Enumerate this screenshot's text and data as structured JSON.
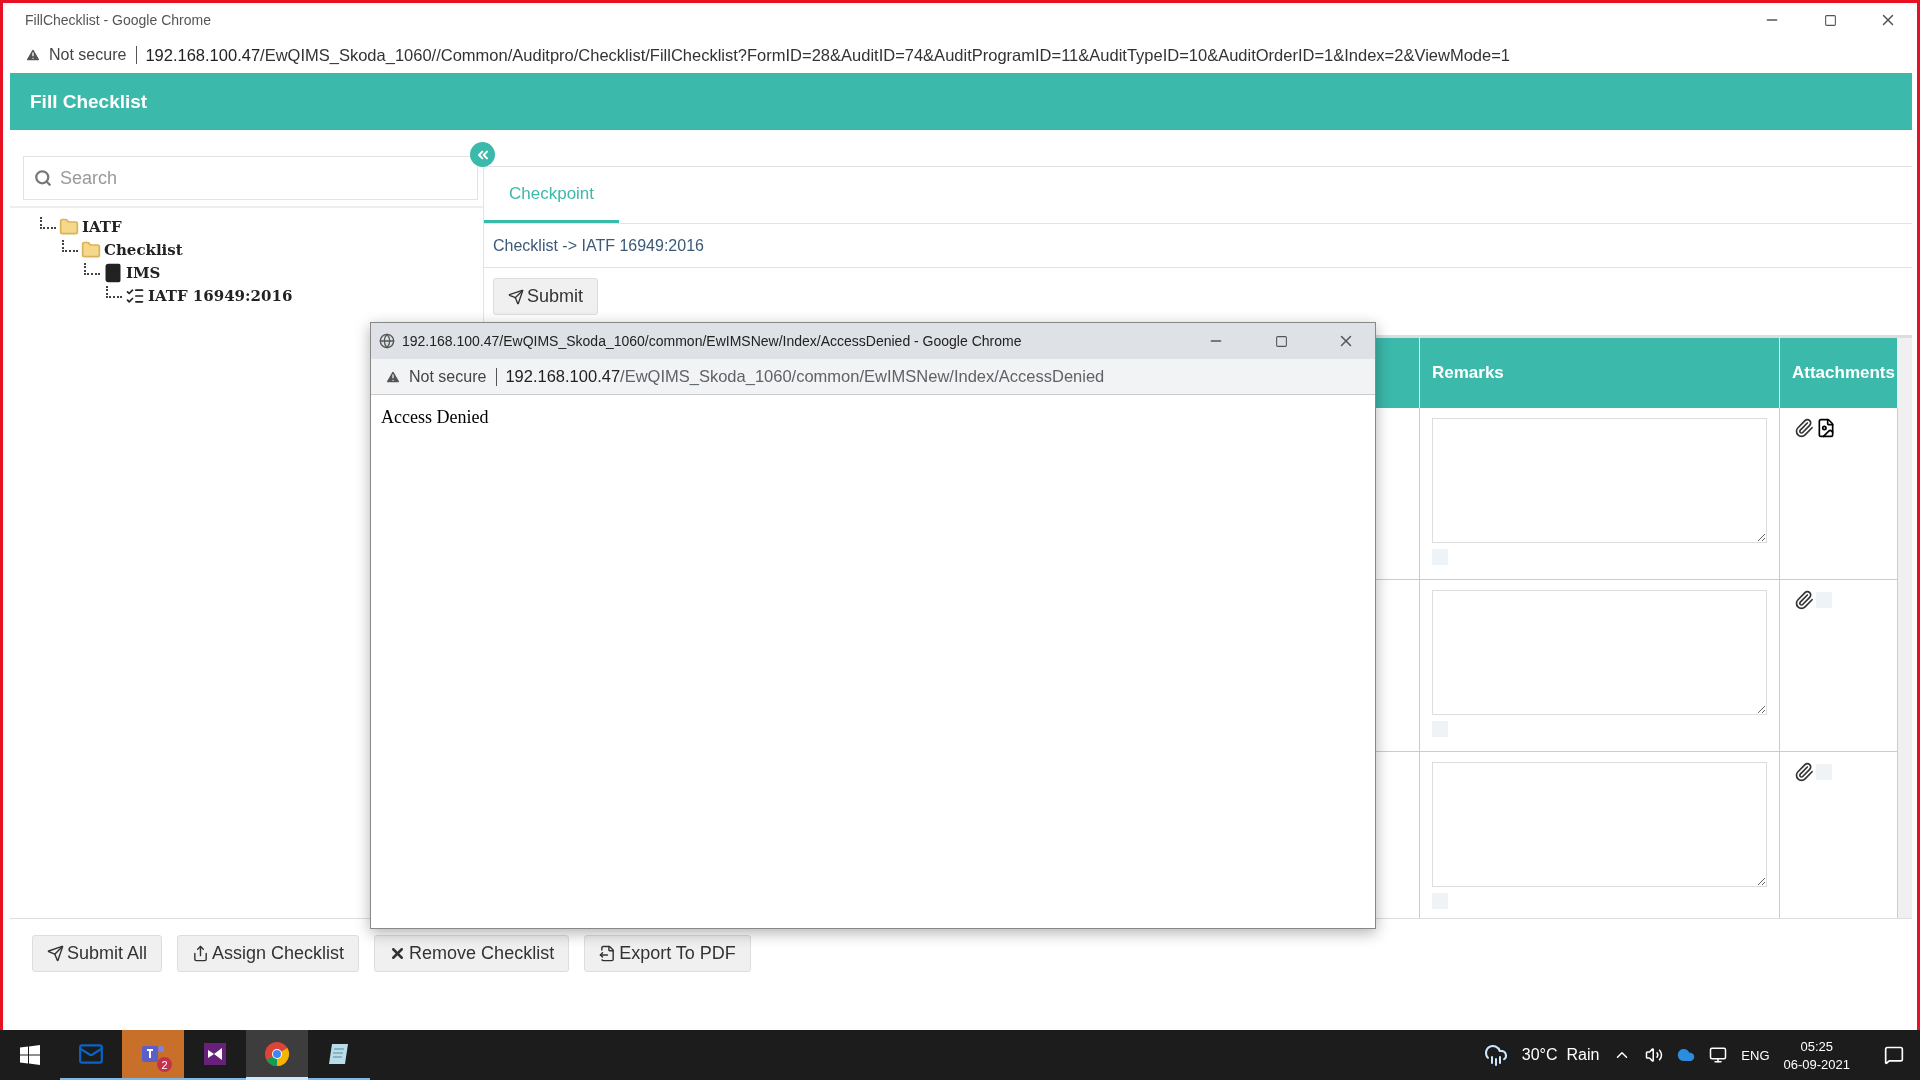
{
  "browser": {
    "title": "FillChecklist - Google Chrome",
    "security": "Not secure",
    "url_host": "192.168.100.47",
    "url_path": "/EwQIMS_Skoda_1060//Common/Auditpro/Checklist/FillChecklist?FormID=28&AuditID=74&AuditProgramID=11&AuditTypeID=10&AuditOrderID=1&Index=2&ViewMode=1"
  },
  "page": {
    "title": "Fill Checklist"
  },
  "sidebar": {
    "search": {
      "placeholder": "Search"
    },
    "tree": [
      {
        "label": "IATF",
        "kind": "folder",
        "children": [
          {
            "label": "Checklist",
            "kind": "folder",
            "children": [
              {
                "label": "IMS",
                "kind": "book",
                "children": [
                  {
                    "label": "IATF 16949:2016",
                    "kind": "checklist"
                  }
                ]
              }
            ]
          }
        ]
      }
    ]
  },
  "tabs": [
    {
      "label": "Checkpoint",
      "selected": true
    }
  ],
  "breadcrumb": "Checklist -> IATF 16949:2016",
  "submit_button": "Submit",
  "table": {
    "columns": [
      "Remarks",
      "Attachments"
    ],
    "rows": [
      {
        "has_photo": true,
        "checked": false
      },
      {
        "has_photo": false,
        "checked": false
      },
      {
        "has_photo": false,
        "checked": false
      }
    ]
  },
  "actions": [
    {
      "label": "Submit All",
      "kind": "send"
    },
    {
      "label": "Assign Checklist",
      "kind": "share"
    },
    {
      "label": "Remove Checklist",
      "kind": "remove"
    },
    {
      "label": "Export To PDF",
      "kind": "export"
    }
  ],
  "popup": {
    "title": "192.168.100.47/EwQIMS_Skoda_1060/common/EwIMSNew/Index/AccessDenied - Google Chrome",
    "security": "Not secure",
    "url_host": "192.168.100.47",
    "url_path": "/EwQIMS_Skoda_1060/common/EwIMSNew/Index/AccessDenied",
    "body": "Access Denied"
  },
  "taskbar": {
    "apps": [
      {
        "kind": "outlook",
        "flashing": false,
        "selected": false
      },
      {
        "kind": "teams",
        "badge": "2",
        "flashing": true,
        "selected": false
      },
      {
        "kind": "studio",
        "flashing": false,
        "selected": false
      },
      {
        "kind": "chrome",
        "flashing": false,
        "selected": true
      },
      {
        "kind": "notes",
        "flashing": false,
        "selected": false
      }
    ],
    "weather": "30°C  Rain",
    "language": "ENG",
    "time": "05:25",
    "date": "06-09-2021"
  }
}
